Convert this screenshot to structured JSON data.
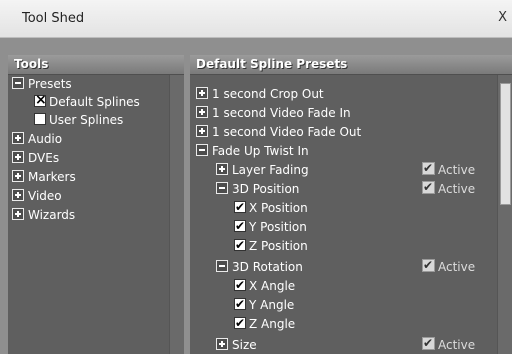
{
  "window": {
    "title": "Tool Shed",
    "close_label": "X"
  },
  "left_pane": {
    "header": "Tools",
    "items": [
      {
        "label": "Presets",
        "kind": "minus"
      },
      {
        "label": "Default Splines",
        "kind": "checkx"
      },
      {
        "label": "User Splines",
        "kind": "empty"
      },
      {
        "label": "Audio",
        "kind": "plus"
      },
      {
        "label": "DVEs",
        "kind": "plus"
      },
      {
        "label": "Markers",
        "kind": "plus"
      },
      {
        "label": "Video",
        "kind": "plus"
      },
      {
        "label": "Wizards",
        "kind": "plus"
      }
    ]
  },
  "right_pane": {
    "header": "Default Spline Presets",
    "active_label": "Active",
    "items": [
      {
        "label": "1 second Crop Out",
        "kind": "plus"
      },
      {
        "label": "1 second Video Fade In",
        "kind": "plus"
      },
      {
        "label": "1 second Video Fade Out",
        "kind": "plus"
      },
      {
        "label": "Fade Up Twist In",
        "kind": "minus"
      },
      {
        "label": "Layer Fading",
        "kind": "plus",
        "active": true
      },
      {
        "label": "3D Position",
        "kind": "minus",
        "active": true
      },
      {
        "label": "X Position",
        "kind": "tick"
      },
      {
        "label": "Y Position",
        "kind": "tick"
      },
      {
        "label": "Z Position",
        "kind": "tick"
      },
      {
        "label": "3D Rotation",
        "kind": "minus",
        "active": true
      },
      {
        "label": "X Angle",
        "kind": "tick"
      },
      {
        "label": "Y Angle",
        "kind": "tick"
      },
      {
        "label": "Z Angle",
        "kind": "tick"
      },
      {
        "label": "Size",
        "kind": "plus",
        "active": true
      }
    ]
  }
}
